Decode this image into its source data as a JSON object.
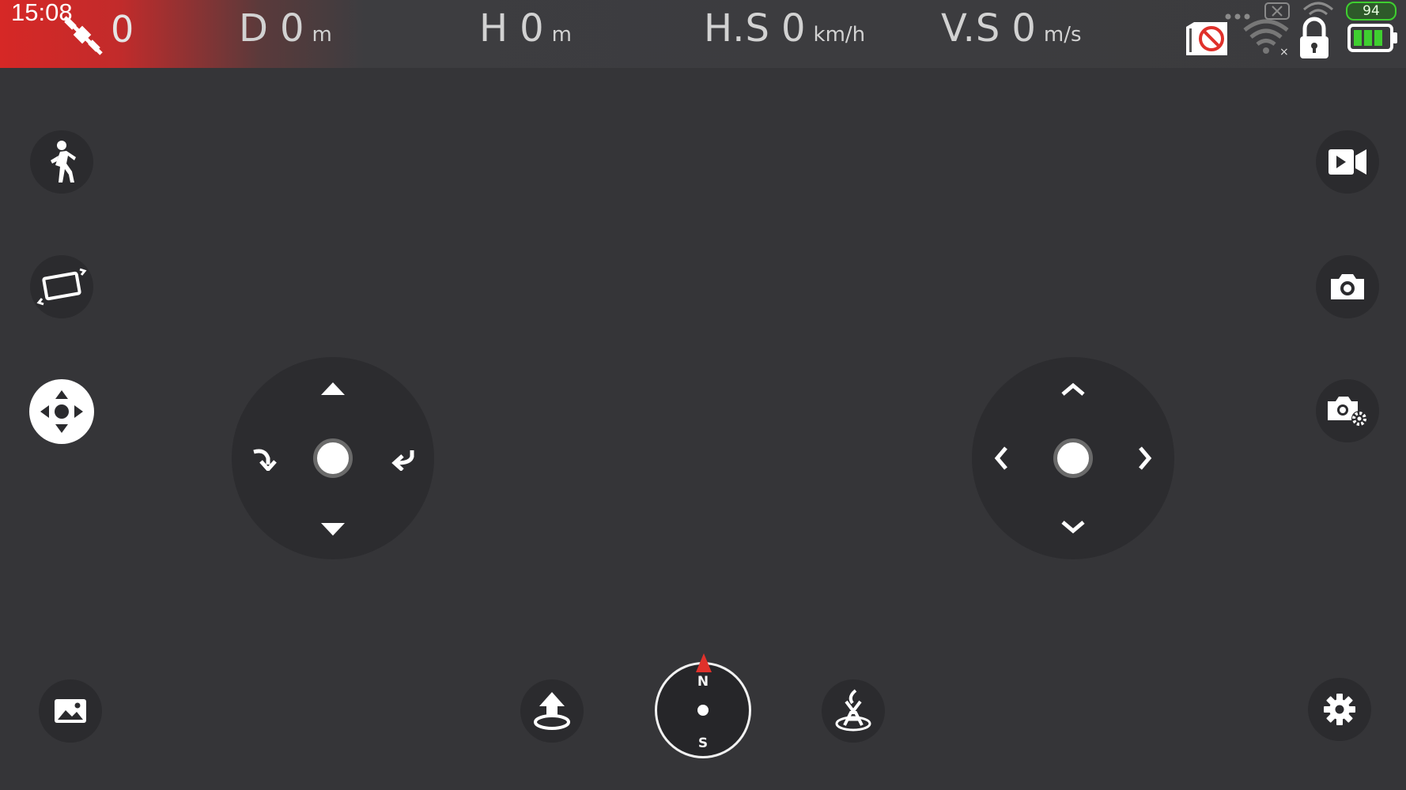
{
  "status_bar": {
    "time": "15:08",
    "satellite_count": "0",
    "distance": {
      "label": "D",
      "value": "0",
      "unit": "m"
    },
    "height": {
      "label": "H",
      "value": "0",
      "unit": "m"
    },
    "horizontal_speed": {
      "label": "H.S",
      "value": "0",
      "unit": "km/h"
    },
    "vertical_speed": {
      "label": "V.S",
      "value": "0",
      "unit": "m/s"
    },
    "battery_percent": "94",
    "icons": [
      "satellite-off-icon",
      "sd-card-blocked-icon",
      "wifi-disconnected-icon",
      "lock-icon",
      "battery-icon"
    ]
  },
  "left_toolbar": [
    "follow-mode-icon",
    "screen-rotate-icon",
    "move-mode-icon",
    "gallery-icon"
  ],
  "right_toolbar": [
    "record-video-icon",
    "take-photo-icon",
    "camera-settings-icon",
    "settings-gear-icon"
  ],
  "bottom_controls": [
    "takeoff-icon",
    "compass",
    "land-icon"
  ],
  "compass": {
    "north": "N",
    "south": "S"
  },
  "colors": {
    "background": "#353538",
    "alert_red": "#d62826",
    "needle_red": "#e0312b",
    "battery_green": "#3fcf30"
  }
}
